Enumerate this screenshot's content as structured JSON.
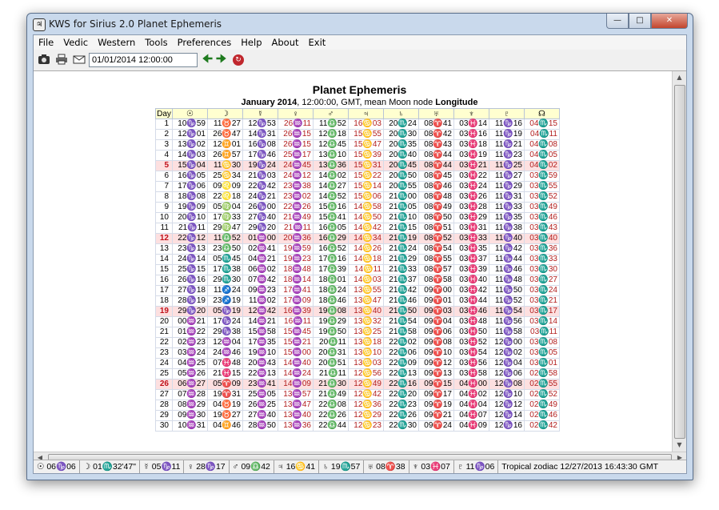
{
  "window": {
    "title": "KWS for Sirius 2.0 Planet Ephemeris"
  },
  "menu": [
    "File",
    "Vedic",
    "Western",
    "Tools",
    "Preferences",
    "Help",
    "About",
    "Exit"
  ],
  "toolbar": {
    "datetime": "01/01/2014   12:00:00"
  },
  "report": {
    "title": "Planet Ephemeris",
    "subtitle_month": "January  2014",
    "subtitle_mid": ", 12:00:00, GMT, mean Moon node ",
    "subtitle_end": "Longitude"
  },
  "table": {
    "headers": [
      "Day",
      "☉",
      "☽",
      "☿",
      "♀",
      "♂",
      "♃",
      "♄",
      "♅",
      "♆",
      "♇",
      "☊"
    ],
    "red_columns": [
      4,
      6,
      11
    ],
    "highlight_days": [
      "5",
      "12",
      "19",
      "26"
    ],
    "rows": [
      [
        "1",
        "10♑59",
        "11♉27",
        "12♑53",
        "26♒11",
        "11♎52",
        "16♋03",
        "20♏24",
        "08♈41",
        "03♓14",
        "11♑16",
        "04♏15"
      ],
      [
        "2",
        "12♑01",
        "26♉47",
        "14♑31",
        "26♒15",
        "12♎18",
        "15♋55",
        "20♏30",
        "08♈42",
        "03♓16",
        "11♑19",
        "04♏11"
      ],
      [
        "3",
        "13♑02",
        "12♊01",
        "16♑08",
        "26♒15",
        "12♎45",
        "15♋47",
        "20♏35",
        "08♈43",
        "03♓18",
        "11♑21",
        "04♏08"
      ],
      [
        "4",
        "14♑03",
        "26♊57",
        "17♑46",
        "25♒17",
        "13♎10",
        "15♋39",
        "20♏40",
        "08♈44",
        "03♓19",
        "11♑23",
        "04♏05"
      ],
      [
        "5",
        "15♑04",
        "11♋30",
        "19♑24",
        "24♒45",
        "13♎36",
        "15♋31",
        "20♏45",
        "08♈44",
        "03♓21",
        "11♑25",
        "04♏02"
      ],
      [
        "6",
        "16♑05",
        "25♋34",
        "21♑03",
        "24♒12",
        "14♎02",
        "15♋22",
        "20♏50",
        "08♈45",
        "03♓22",
        "11♑27",
        "03♏59"
      ],
      [
        "7",
        "17♑06",
        "09♌09",
        "22♑42",
        "23♒38",
        "14♎27",
        "15♋14",
        "20♏55",
        "08♈46",
        "03♓24",
        "11♑29",
        "03♏55"
      ],
      [
        "8",
        "18♑08",
        "22♌18",
        "24♑21",
        "23♒02",
        "14♎52",
        "15♋06",
        "21♏00",
        "08♈48",
        "03♓26",
        "11♑31",
        "03♏52"
      ],
      [
        "9",
        "19♑09",
        "05♍04",
        "26♑00",
        "22♒26",
        "15♎16",
        "14♋58",
        "21♏05",
        "08♈49",
        "03♓28",
        "11♑33",
        "03♏49"
      ],
      [
        "10",
        "20♑10",
        "17♍33",
        "27♑40",
        "21♒49",
        "15♎41",
        "14♋50",
        "21♏10",
        "08♈50",
        "03♓29",
        "11♑35",
        "03♏46"
      ],
      [
        "11",
        "21♑11",
        "29♍47",
        "29♑20",
        "21♒11",
        "16♎05",
        "14♋42",
        "21♏15",
        "08♈51",
        "03♓31",
        "11♑38",
        "03♏43"
      ],
      [
        "12",
        "22♑12",
        "11♎52",
        "01♒00",
        "20♒36",
        "16♎29",
        "14♋34",
        "21♏19",
        "08♈52",
        "03♓33",
        "11♑40",
        "03♏40"
      ],
      [
        "13",
        "23♑13",
        "23♎50",
        "02♒41",
        "19♒59",
        "16♎52",
        "14♋26",
        "21♏24",
        "08♈54",
        "03♓35",
        "11♑42",
        "03♏36"
      ],
      [
        "14",
        "24♑14",
        "05♏45",
        "04♒21",
        "19♒23",
        "17♎16",
        "14♋18",
        "21♏29",
        "08♈55",
        "03♓37",
        "11♑44",
        "03♏33"
      ],
      [
        "15",
        "25♑15",
        "17♏38",
        "06♒02",
        "18♒48",
        "17♎39",
        "14♋11",
        "21♏33",
        "08♈57",
        "03♓39",
        "11♑46",
        "03♏30"
      ],
      [
        "16",
        "26♑16",
        "29♏30",
        "07♒42",
        "18♒14",
        "18♎01",
        "14♋03",
        "21♏37",
        "08♈58",
        "03♓40",
        "11♑48",
        "03♏27"
      ],
      [
        "17",
        "27♑18",
        "11♐24",
        "09♒23",
        "17♒41",
        "18♎24",
        "13♋55",
        "21♏42",
        "09♈00",
        "03♓42",
        "11♑50",
        "03♏24"
      ],
      [
        "18",
        "28♑19",
        "23♐19",
        "11♒02",
        "17♒09",
        "18♎46",
        "13♋47",
        "21♏46",
        "09♈01",
        "03♓44",
        "11♑52",
        "03♏21"
      ],
      [
        "19",
        "29♑20",
        "05♑19",
        "12♒42",
        "16♒39",
        "19♎08",
        "13♋40",
        "21♏50",
        "09♈03",
        "03♓46",
        "11♑54",
        "03♏17"
      ],
      [
        "20",
        "00♒21",
        "17♑24",
        "14♒21",
        "16♒11",
        "19♎29",
        "13♋32",
        "21♏54",
        "09♈04",
        "03♓48",
        "11♑56",
        "03♏14"
      ],
      [
        "21",
        "01♒22",
        "29♑38",
        "15♒58",
        "15♒45",
        "19♎50",
        "13♋25",
        "21♏58",
        "09♈06",
        "03♓50",
        "11♑58",
        "03♏11"
      ],
      [
        "22",
        "02♒23",
        "12♒04",
        "17♒35",
        "15♒21",
        "20♎11",
        "13♋18",
        "22♏02",
        "09♈08",
        "03♓52",
        "12♑00",
        "03♏08"
      ],
      [
        "23",
        "03♒24",
        "24♒46",
        "19♒10",
        "15♒00",
        "20♎31",
        "13♋10",
        "22♏06",
        "09♈10",
        "03♓54",
        "12♑02",
        "03♏05"
      ],
      [
        "24",
        "04♒25",
        "07♓48",
        "20♒43",
        "14♒40",
        "20♎51",
        "13♋03",
        "22♏09",
        "09♈12",
        "03♓56",
        "12♑04",
        "03♏01"
      ],
      [
        "25",
        "05♒26",
        "21♓15",
        "22♒13",
        "14♒24",
        "21♎11",
        "12♋56",
        "22♏13",
        "09♈13",
        "03♓58",
        "12♑06",
        "02♏58"
      ],
      [
        "26",
        "06♒27",
        "05♈09",
        "23♒41",
        "14♒09",
        "21♎30",
        "12♋49",
        "22♏16",
        "09♈15",
        "04♓00",
        "12♑08",
        "02♏55"
      ],
      [
        "27",
        "07♒28",
        "19♈31",
        "25♒05",
        "13♒57",
        "21♎49",
        "12♋42",
        "22♏20",
        "09♈17",
        "04♓02",
        "12♑10",
        "02♏52"
      ],
      [
        "28",
        "08♒29",
        "04♉19",
        "26♒25",
        "13♒47",
        "22♎08",
        "12♋36",
        "22♏23",
        "09♈19",
        "04♓04",
        "12♑12",
        "02♏49"
      ],
      [
        "29",
        "09♒30",
        "19♉27",
        "27♒40",
        "13♒40",
        "22♎26",
        "12♋29",
        "22♏26",
        "09♈21",
        "04♓07",
        "12♑14",
        "02♏46"
      ],
      [
        "30",
        "10♒31",
        "04♊46",
        "28♒50",
        "13♒36",
        "22♎44",
        "12♋23",
        "22♏30",
        "09♈24",
        "04♓09",
        "12♑16",
        "02♏42"
      ]
    ]
  },
  "status": {
    "sun": "06♑06",
    "moon": "01♏32'47\"",
    "mercury": "05♑11",
    "venus": "28♑17",
    "mars": "09♎42",
    "jupiter": "16♋41",
    "saturn": "19♏57",
    "uranus": "08♈38",
    "neptune": "03♓07",
    "pluto": "11♑06",
    "info": "Tropical zodiac 12/27/2013 16:43:30 GMT"
  },
  "status_glyphs": {
    "sun": "☉",
    "moon": "☽",
    "mercury": "☿",
    "venus": "♀",
    "mars": "♂",
    "jupiter": "♃",
    "saturn": "♄",
    "uranus": "♅",
    "neptune": "♆",
    "pluto": "♇"
  }
}
